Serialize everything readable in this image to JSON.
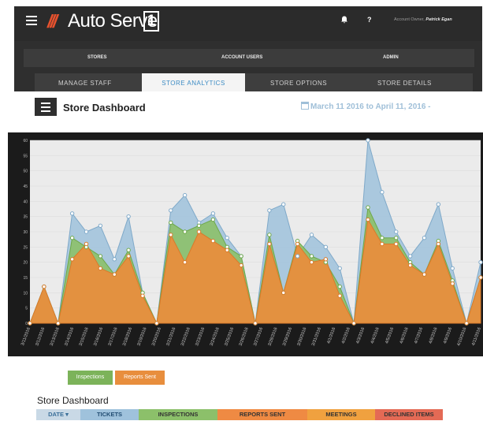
{
  "header": {
    "logo_slash": "///",
    "logo_text": "Auto Serve",
    "logo_one": "1",
    "help": "?",
    "account_label": "Account Owner,",
    "account_name": "Patrick Egan"
  },
  "nav_top": [
    "STORES",
    "ACCOUNT USERS",
    "ADMIN"
  ],
  "nav_tabs": [
    "MANAGE STAFF",
    "STORE ANALYTICS",
    "STORE OPTIONS",
    "STORE DETAILS"
  ],
  "active_tab": "STORE ANALYTICS",
  "dashboard": {
    "title": "Store Dashboard",
    "date_range": "March 11  2016 to April 11, 2016 -"
  },
  "legend": [
    "Inspections",
    "Reports Sent"
  ],
  "table": {
    "title": "Store Dashboard",
    "columns": [
      "DATE ▾",
      "TICKETS",
      "INSPECTIONS",
      "REPORTS SENT",
      "MEETINGS",
      "DECLINED ITEMS"
    ],
    "column_colors": [
      "#c9d9e6",
      "#9fc2dc",
      "#8cc06a",
      "#ef8a43",
      "#f0a13f",
      "#e46a55"
    ]
  },
  "chart_data": {
    "type": "area",
    "y_ticks": [
      0,
      5,
      10,
      15,
      20,
      25,
      30,
      35,
      40,
      45,
      50,
      55,
      60
    ],
    "ylim": [
      0,
      60
    ],
    "colors": {
      "tickets": "#9fc2dc",
      "inspections": "#8cc06a",
      "reports_sent": "#e88e3d"
    },
    "x": [
      "3/11/2016",
      "3/12/2016",
      "3/13/2016",
      "3/14/2016",
      "3/15/2016",
      "3/16/2016",
      "3/17/2016",
      "3/18/2016",
      "3/19/2016",
      "3/20/2016",
      "3/21/2016",
      "3/22/2016",
      "3/23/2016",
      "3/24/2016",
      "3/25/2016",
      "3/26/2016",
      "3/27/2016",
      "3/28/2016",
      "3/29/2016",
      "3/30/2016",
      "3/31/2016",
      "4/1/2016",
      "4/2/2016",
      "4/3/2016",
      "4/4/2016",
      "4/5/2016",
      "4/6/2016",
      "4/7/2016",
      "4/8/2016",
      "4/9/2016",
      "4/10/2016",
      "4/11/2016"
    ],
    "series": [
      {
        "values": [
          0,
          12,
          0,
          36,
          30,
          32,
          21,
          35,
          10,
          0,
          37,
          42,
          33,
          36,
          28,
          22,
          0,
          37,
          39,
          22,
          29,
          25,
          18,
          0,
          60,
          43,
          30,
          22,
          28,
          39,
          18,
          0,
          20
        ]
      },
      {
        "values": [
          0,
          12,
          0,
          28,
          25,
          22,
          16,
          24,
          10,
          0,
          33,
          30,
          32,
          34,
          25,
          22,
          0,
          29,
          10,
          27,
          22,
          20,
          12,
          0,
          38,
          28,
          28,
          20,
          16,
          27,
          14,
          0,
          15
        ]
      },
      {
        "values": [
          0,
          12,
          0,
          21,
          26,
          18,
          16,
          22,
          9,
          0,
          29,
          20,
          30,
          27,
          24,
          19,
          0,
          26,
          10,
          26,
          20,
          21,
          9,
          0,
          34,
          26,
          26,
          19,
          16,
          26,
          13,
          0,
          15
        ]
      }
    ]
  }
}
